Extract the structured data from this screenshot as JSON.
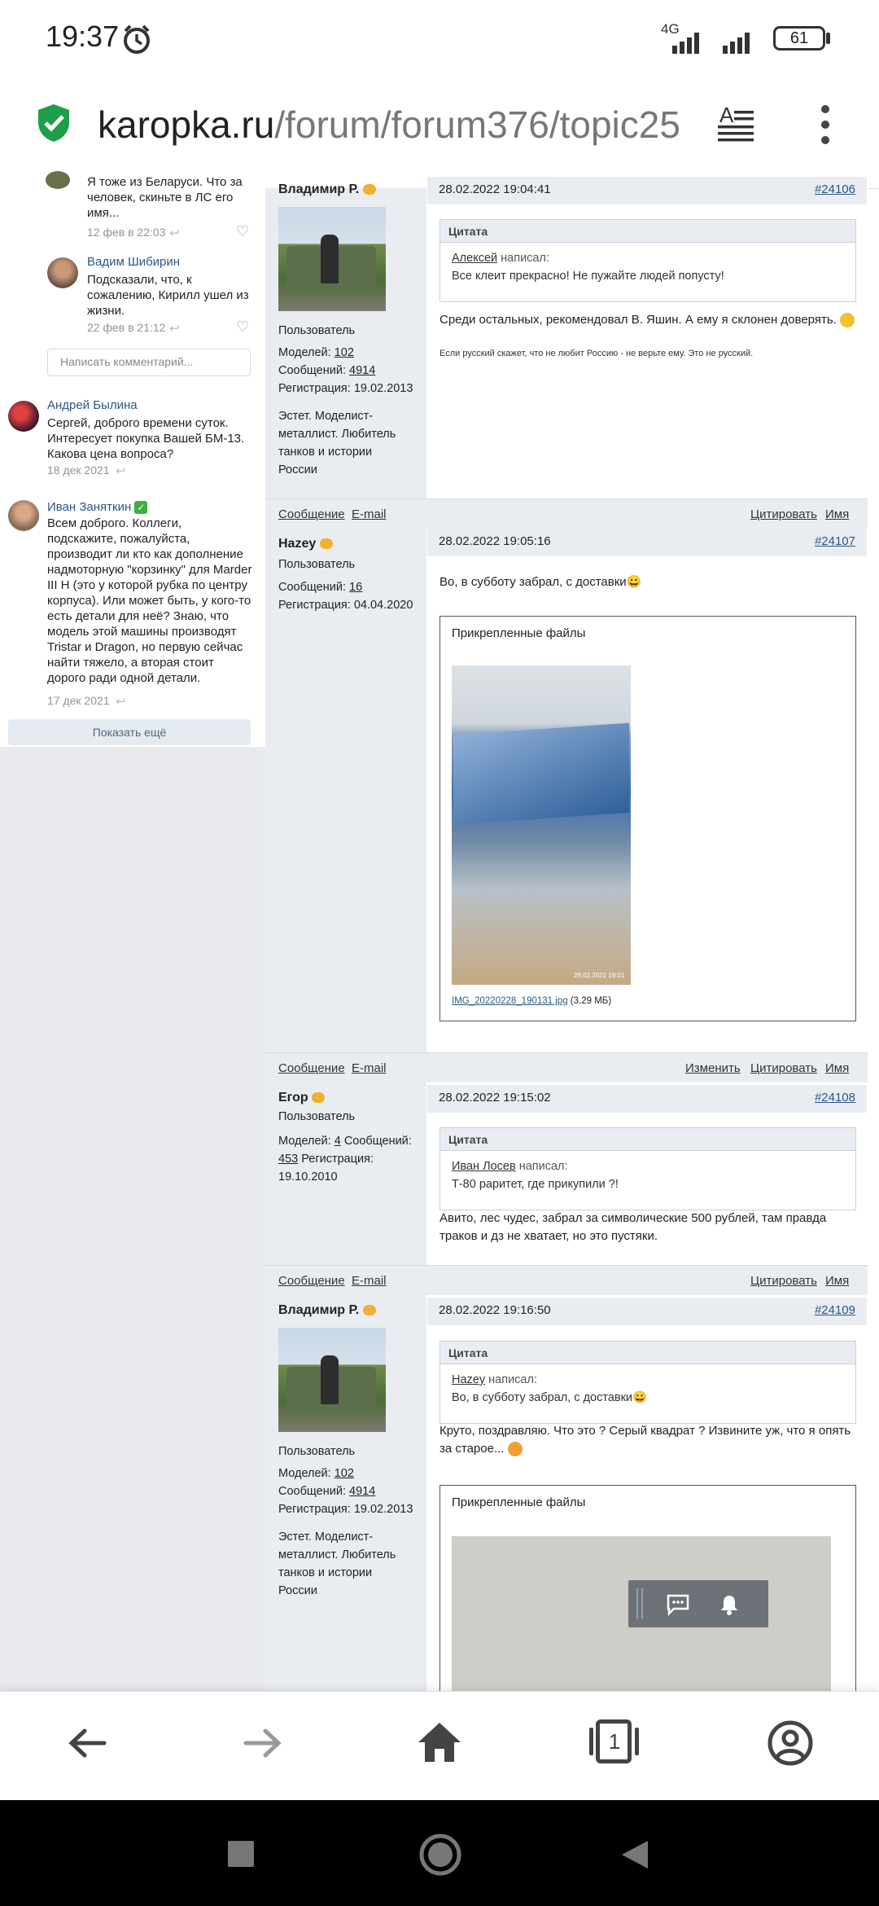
{
  "status_bar": {
    "time": "19:37",
    "network": "4G",
    "battery": "61"
  },
  "address_bar": {
    "domain": "karopka.ru",
    "path": "/forum/forum376/topic25"
  },
  "comments": {
    "partial": {
      "text": "Я тоже из Беларуси. Что за человек, скиньте в ЛС его имя...",
      "date": "12 фев в 22:03"
    },
    "items": [
      {
        "author": "Вадим Шибирин",
        "text": "Подсказали, что, к сожалению, Кирилл ушел из жизни.",
        "date": "22 фев в 21:12"
      }
    ],
    "input_placeholder": "Написать комментарий...",
    "top_items": [
      {
        "author": "Андрей Былина",
        "text": "Сергей, доброго времени суток. Интересует покупка Вашей БМ-13. Какова цена вопроса?",
        "date": "18 дек 2021"
      },
      {
        "author": "Иван Заняткин",
        "text": "Всем доброго. Коллеги, подскажите, пожалуйста, производит ли кто как дополнение надмоторную \"корзинку\" для Marder III H (это у которой рубка по центру корпуса). Или может быть, у кого-то есть детали для неё? Знаю, что модель этой машины производят Tristar и Dragon, но первую сейчас найти тяжело, а вторая стоит дорого ради одной детали.",
        "date": "17 дек 2021"
      }
    ],
    "show_more": "Показать ещё"
  },
  "posts": [
    {
      "author": "Владимир Р.",
      "role": "Пользователь",
      "models_label": "Моделей:",
      "models": "102",
      "messages_label": "Сообщений:",
      "messages": "4914",
      "reg_label": "Регистрация:",
      "reg": "19.02.2013",
      "about": "Эстет. Моделист-металлист. Любитель танков и истории России",
      "datetime": "28.02.2022 19:04:41",
      "number": "#24106",
      "quote_title": "Цитата",
      "quote_author": "Алексей",
      "quote_wrote": "написал:",
      "quote_text": "Все клеит прекрасно! Не пужайте людей попусту!",
      "text": "Среди остальных, рекомендовал В. Яшин. А ему я склонен доверять.",
      "signature": "Если русский скажет, что не любит Россию - не верьте ему. Это не русский."
    },
    {
      "author": "Hazey",
      "role": "Пользователь",
      "messages_label": "Сообщений:",
      "messages": "16",
      "reg_label": "Регистрация:",
      "reg": "04.04.2020",
      "datetime": "28.02.2022 19:05:16",
      "number": "#24107",
      "text": "Во, в субботу забрал,  с доставки😀",
      "attach_title": "Прикрепленные файлы",
      "file_name": "IMG_20220228_190131.jpg",
      "file_size": "(3.29 МБ)",
      "photo_stamp": "28.02.2022 19:01"
    },
    {
      "author": "Егор",
      "role": "Пользователь",
      "models_label": "Моделей:",
      "models": "4",
      "messages_label": "Сообщений:",
      "messages": "453",
      "reg_label": "Регистрация:",
      "reg": "19.10.2010",
      "datetime": "28.02.2022 19:15:02",
      "number": "#24108",
      "quote_title": "Цитата",
      "quote_author": "Иван Лосев",
      "quote_wrote": "написал:",
      "quote_text": "Т-80 раритет, где прикупили ?!",
      "text": "Авито, лес чудес, забрал за символические 500 рублей, там правда траков и дз не хватает, но это пустяки."
    },
    {
      "author": "Владимир Р.",
      "role": "Пользователь",
      "models_label": "Моделей:",
      "models": "102",
      "messages_label": "Сообщений:",
      "messages": "4914",
      "reg_label": "Регистрация:",
      "reg": "19.02.2013",
      "about": "Эстет. Моделист-металлист. Любитель танков и истории России",
      "datetime": "28.02.2022 19:16:50",
      "number": "#24109",
      "quote_title": "Цитата",
      "quote_author": "Hazey",
      "quote_wrote": "написал:",
      "quote_text": "Во, в субботу забрал,  с доставки😀",
      "text": "Круто, поздравляю. Что это ? Серый квадрат ? Извините уж, что я опять за старое...",
      "attach_title": "Прикрепленные файлы"
    }
  ],
  "actions": {
    "message": "Сообщение",
    "email": "E-mail",
    "edit": "Изменить",
    "quote": "Цитировать",
    "name": "Имя"
  },
  "bottom_nav": {
    "tabs_count": "1"
  }
}
